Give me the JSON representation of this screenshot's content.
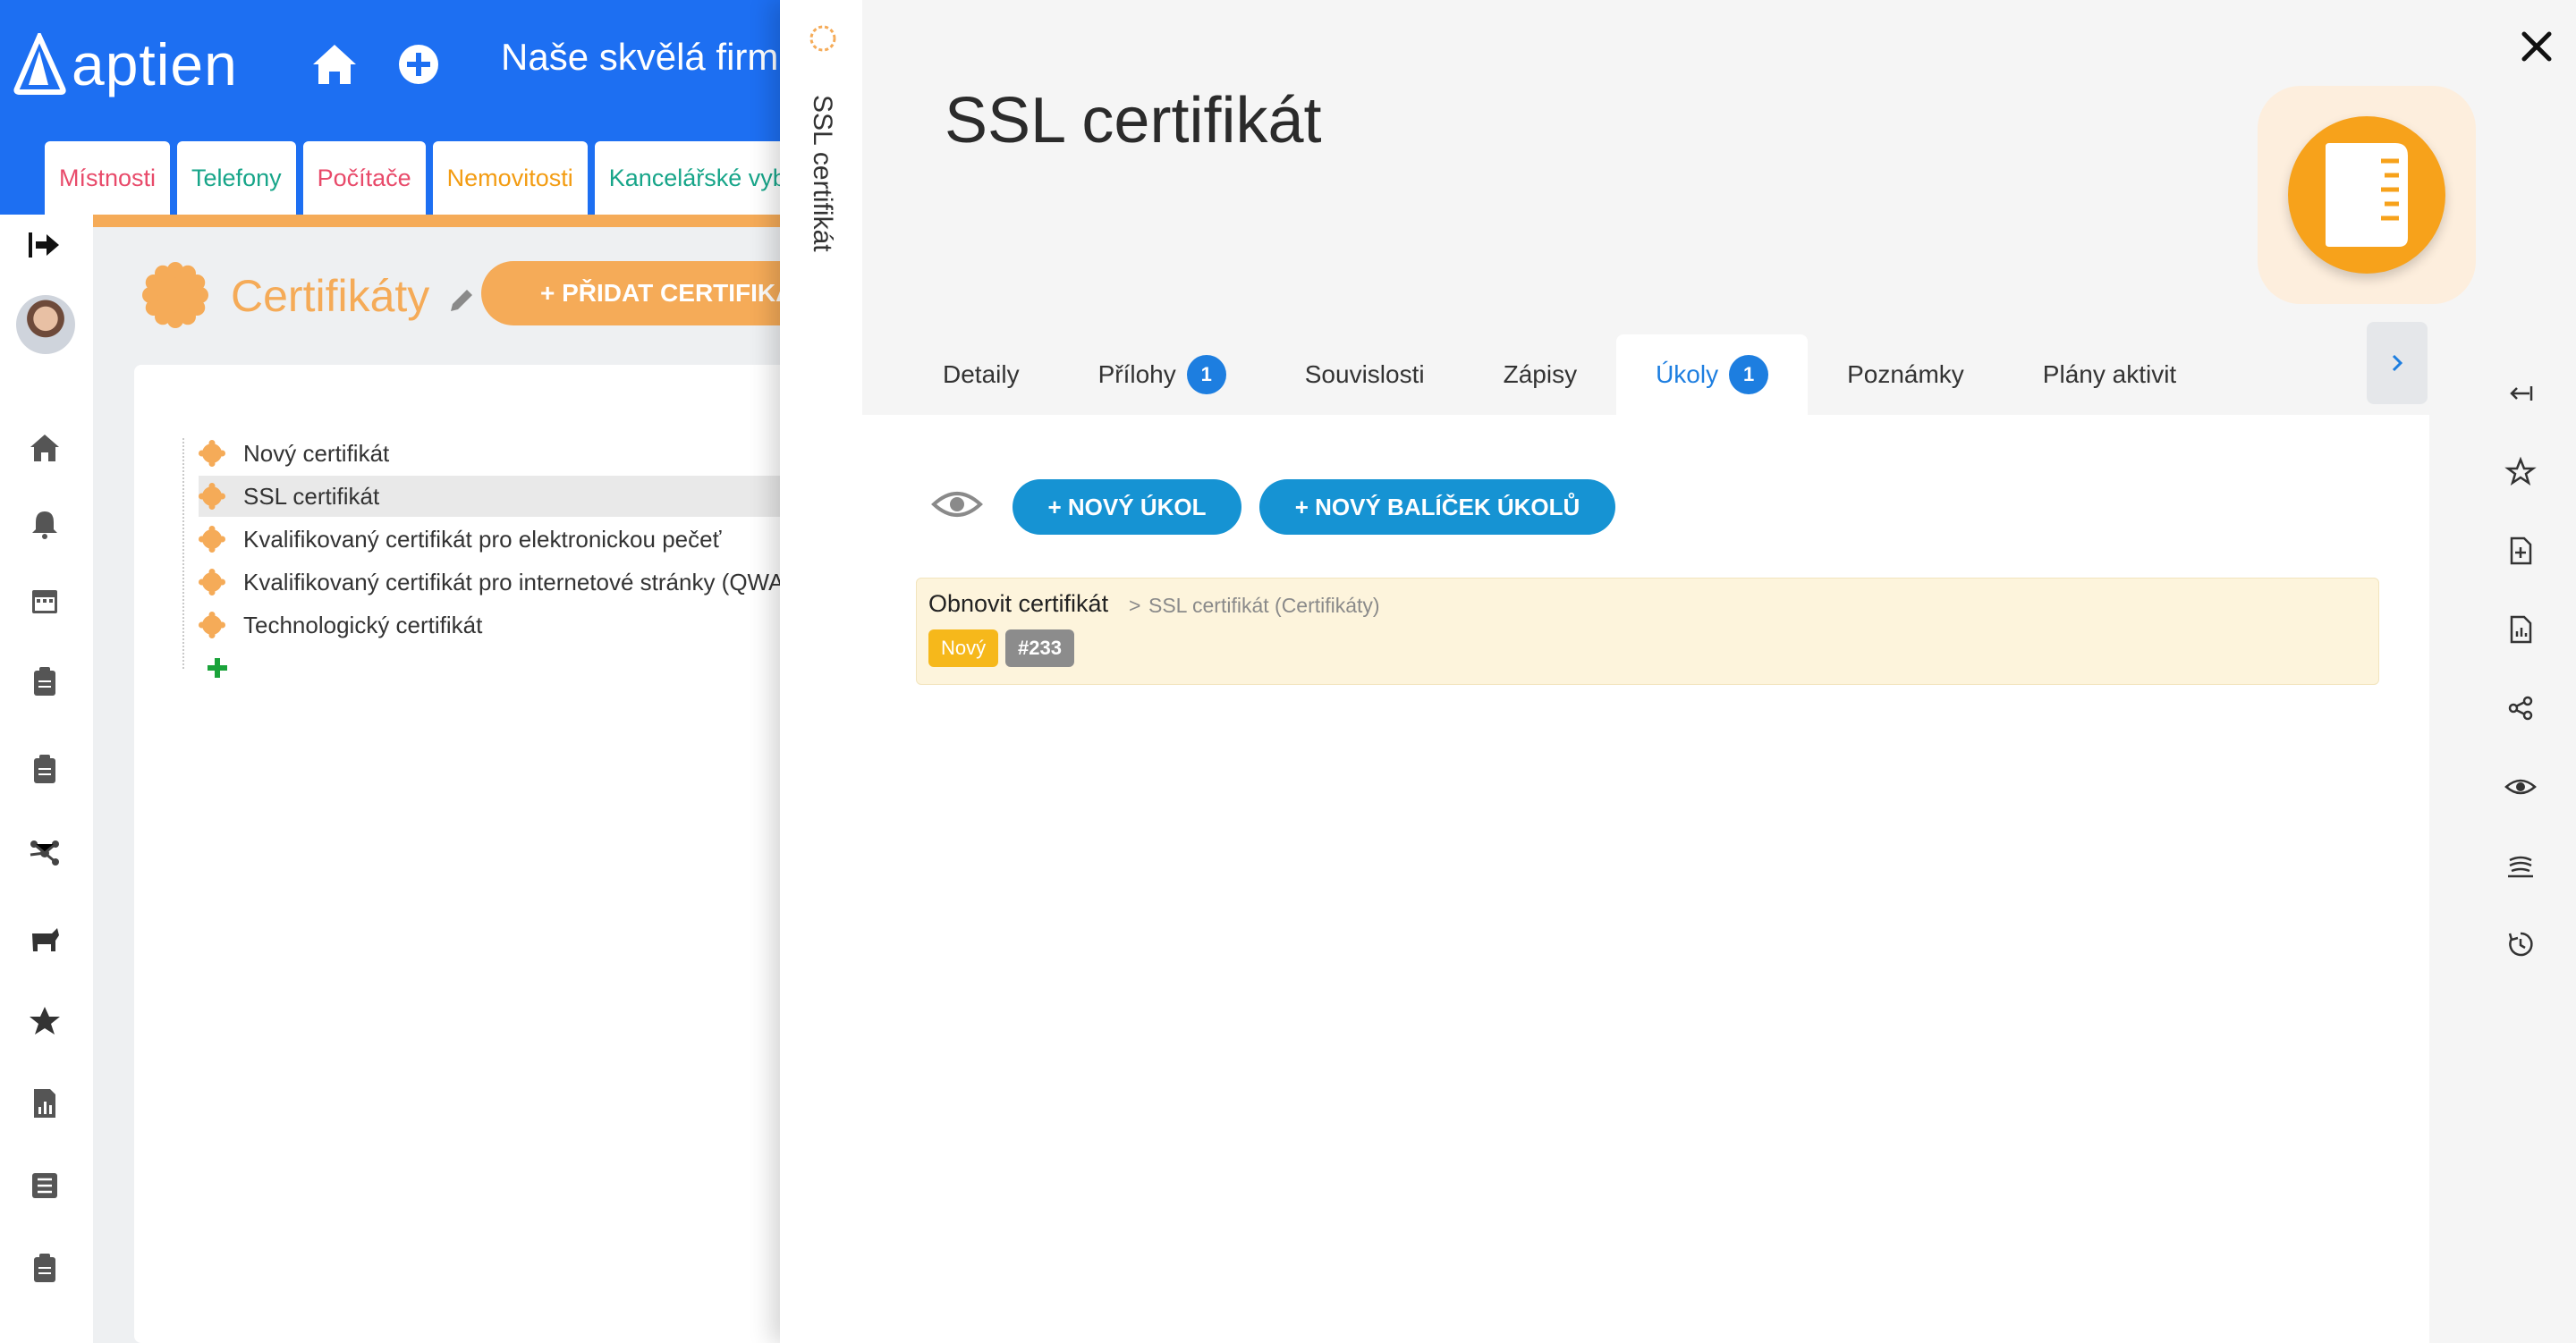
{
  "app": {
    "logo_text": "aptien",
    "company": "Naše skvělá firma",
    "tabs": [
      {
        "label": "Místnosti",
        "color": "#e84a6a"
      },
      {
        "label": "Telefony",
        "color": "#17a589"
      },
      {
        "label": "Počítače",
        "color": "#e84a6a"
      },
      {
        "label": "Nemovitosti",
        "color": "#f39c12"
      },
      {
        "label": "Kancelářské vyb",
        "color": "#17a589"
      }
    ]
  },
  "category": {
    "title": "Certifikáty",
    "add_button": "+ PŘIDAT CERTIFIKÁT",
    "tree": [
      {
        "label": "Nový certifikát",
        "selected": false
      },
      {
        "label": "SSL certifikát",
        "selected": true
      },
      {
        "label": "Kvalifikovaný certifikát pro elektronickou pečeť",
        "selected": false
      },
      {
        "label": "Kvalifikovaný certifikát pro internetové stránky (QWAC)",
        "selected": false
      },
      {
        "label": "Technologický certifikát",
        "selected": false
      }
    ]
  },
  "detail": {
    "side_title": "SSL certifikát",
    "title": "SSL certifikát",
    "tabs": [
      {
        "label": "Detaily",
        "badge": ""
      },
      {
        "label": "Přílohy",
        "badge": "1"
      },
      {
        "label": "Souvislosti",
        "badge": ""
      },
      {
        "label": "Zápisy",
        "badge": ""
      },
      {
        "label": "Úkoly",
        "badge": "1"
      },
      {
        "label": "Poznámky",
        "badge": ""
      },
      {
        "label": "Plány aktivit",
        "badge": ""
      }
    ],
    "active_tab": "Úkoly",
    "buttons": {
      "new_task": "+ NOVÝ ÚKOL",
      "new_task_pack": "+ NOVÝ BALÍČEK ÚKOLŮ"
    },
    "task": {
      "title": "Obnovit certifikát",
      "separator": ">",
      "path": "SSL certifikát (Certifikáty)",
      "status": "Nový",
      "id": "#233"
    }
  },
  "colors": {
    "brand_blue": "#1d6ff2",
    "accent_orange": "#f5ab58",
    "button_blue": "#1693d3",
    "task_bg": "#fdf4dc"
  }
}
